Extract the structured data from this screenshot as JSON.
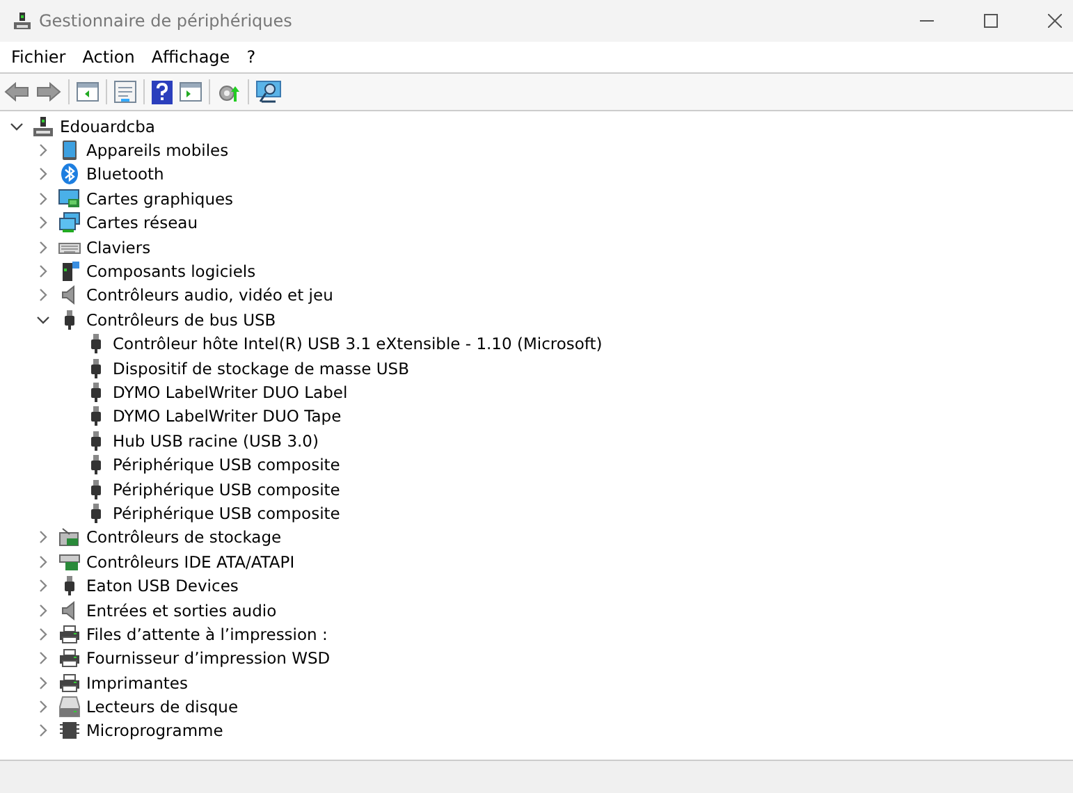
{
  "window": {
    "title": "Gestionnaire de périphériques"
  },
  "menu": [
    "Fichier",
    "Action",
    "Affichage",
    "?"
  ],
  "tree": {
    "label": "Edouardcba",
    "kind": "computer",
    "expanded": true,
    "children": [
      {
        "label": "Appareils mobiles",
        "kind": "mobile",
        "expanded": false
      },
      {
        "label": "Bluetooth",
        "kind": "bluetooth",
        "expanded": false
      },
      {
        "label": "Cartes graphiques",
        "kind": "display",
        "expanded": false
      },
      {
        "label": "Cartes réseau",
        "kind": "network",
        "expanded": false
      },
      {
        "label": "Claviers",
        "kind": "keyboard",
        "expanded": false
      },
      {
        "label": "Composants logiciels",
        "kind": "software",
        "expanded": false
      },
      {
        "label": "Contrôleurs audio, vidéo et jeu",
        "kind": "audio",
        "expanded": false
      },
      {
        "label": "Contrôleurs de bus USB",
        "kind": "usb",
        "expanded": true,
        "children": [
          {
            "label": "Contrôleur hôte Intel(R) USB 3.1 eXtensible - 1.10 (Microsoft)",
            "kind": "usb"
          },
          {
            "label": "Dispositif de stockage de masse USB",
            "kind": "usb"
          },
          {
            "label": "DYMO LabelWriter DUO Label",
            "kind": "usb"
          },
          {
            "label": "DYMO LabelWriter DUO Tape",
            "kind": "usb"
          },
          {
            "label": "Hub USB racine (USB 3.0)",
            "kind": "usb"
          },
          {
            "label": "Périphérique USB composite",
            "kind": "usb"
          },
          {
            "label": "Périphérique USB composite",
            "kind": "usb"
          },
          {
            "label": "Périphérique USB composite",
            "kind": "usb"
          }
        ]
      },
      {
        "label": "Contrôleurs de stockage",
        "kind": "storage",
        "expanded": false
      },
      {
        "label": "Contrôleurs IDE ATA/ATAPI",
        "kind": "ide",
        "expanded": false
      },
      {
        "label": "Eaton USB Devices",
        "kind": "usb",
        "expanded": false
      },
      {
        "label": "Entrées et sorties audio",
        "kind": "audio",
        "expanded": false
      },
      {
        "label": "Files d’attente à l’impression :",
        "kind": "printer",
        "expanded": false
      },
      {
        "label": "Fournisseur d’impression WSD",
        "kind": "printer",
        "expanded": false
      },
      {
        "label": "Imprimantes",
        "kind": "printer",
        "expanded": false
      },
      {
        "label": "Lecteurs de disque",
        "kind": "disk",
        "expanded": false
      },
      {
        "label": "Microprogramme",
        "kind": "chip",
        "expanded": false
      }
    ]
  }
}
